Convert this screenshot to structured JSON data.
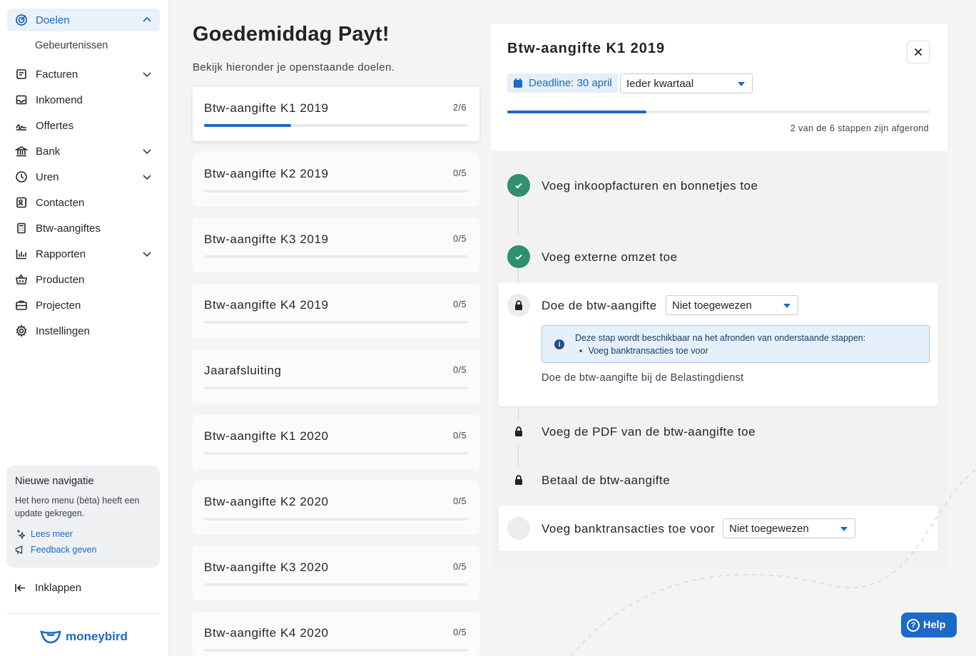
{
  "sidebar": {
    "items": [
      {
        "label": "Doelen",
        "icon": "target-icon",
        "active": true,
        "chevron": "up"
      },
      {
        "label": "Facturen",
        "icon": "invoice-icon",
        "chevron": "down"
      },
      {
        "label": "Inkomend",
        "icon": "inbox-icon"
      },
      {
        "label": "Offertes",
        "icon": "signature-icon"
      },
      {
        "label": "Bank",
        "icon": "bank-icon",
        "chevron": "down"
      },
      {
        "label": "Uren",
        "icon": "clock-icon",
        "chevron": "down"
      },
      {
        "label": "Contacten",
        "icon": "contact-card-icon"
      },
      {
        "label": "Btw-aangiftes",
        "icon": "calculator-icon"
      },
      {
        "label": "Rapporten",
        "icon": "chart-icon",
        "chevron": "down"
      },
      {
        "label": "Producten",
        "icon": "basket-icon"
      },
      {
        "label": "Projecten",
        "icon": "briefcase-icon"
      },
      {
        "label": "Instellingen",
        "icon": "gear-icon"
      }
    ],
    "sub_item": "Gebeurtenissen",
    "promo": {
      "title": "Nieuwe navigatie",
      "text": "Het hero menu (bèta) heeft een update gekregen.",
      "read_more": "Lees meer",
      "feedback": "Feedback geven"
    },
    "collapse": "Inklappen",
    "logo": "moneybird"
  },
  "main": {
    "greeting": "Goedemiddag Payt!",
    "subtitle": "Bekijk hieronder je openstaande doelen.",
    "goals": [
      {
        "title": "Btw-aangifte K1 2019",
        "count": "2/6",
        "progress": 0.33
      },
      {
        "title": "Btw-aangifte K2 2019",
        "count": "0/5",
        "progress": 0
      },
      {
        "title": "Btw-aangifte K3 2019",
        "count": "0/5",
        "progress": 0
      },
      {
        "title": "Btw-aangifte K4 2019",
        "count": "0/5",
        "progress": 0
      },
      {
        "title": "Jaarafsluiting",
        "count": "0/5",
        "progress": 0
      },
      {
        "title": "Btw-aangifte K1 2020",
        "count": "0/5",
        "progress": 0
      },
      {
        "title": "Btw-aangifte K2 2020",
        "count": "0/5",
        "progress": 0
      },
      {
        "title": "Btw-aangifte K3 2020",
        "count": "0/5",
        "progress": 0
      },
      {
        "title": "Btw-aangifte K4 2020",
        "count": "0/5",
        "progress": 0
      }
    ]
  },
  "panel": {
    "title": "Btw-aangifte K1 2019",
    "deadline": "Deadline: 30 april",
    "frequency": "Ieder kwartaal",
    "progress": 0.33,
    "status": "2 van de 6 stappen zijn afgerond",
    "steps": {
      "s1": "Voeg inkoopfacturen en bonnetjes toe",
      "s2": "Voeg externe omzet toe",
      "s3": "Doe de btw-aangifte",
      "s3_assign": "Niet toegewezen",
      "s3_info": "Deze stap wordt beschikbaar na het afronden van onderstaande stappen:",
      "s3_info_item": "Voeg banktransacties toe voor",
      "s3_desc": "Doe de btw-aangifte bij de Belastingdienst",
      "s4": "Voeg de PDF van de btw-aangifte toe",
      "s5": "Betaal de btw-aangifte",
      "s6": "Voeg banktransacties toe voor",
      "s6_assign": "Niet toegewezen"
    }
  },
  "help": "Help",
  "colors": {
    "accent": "#1b6ac9",
    "done": "#2f8f6f"
  }
}
